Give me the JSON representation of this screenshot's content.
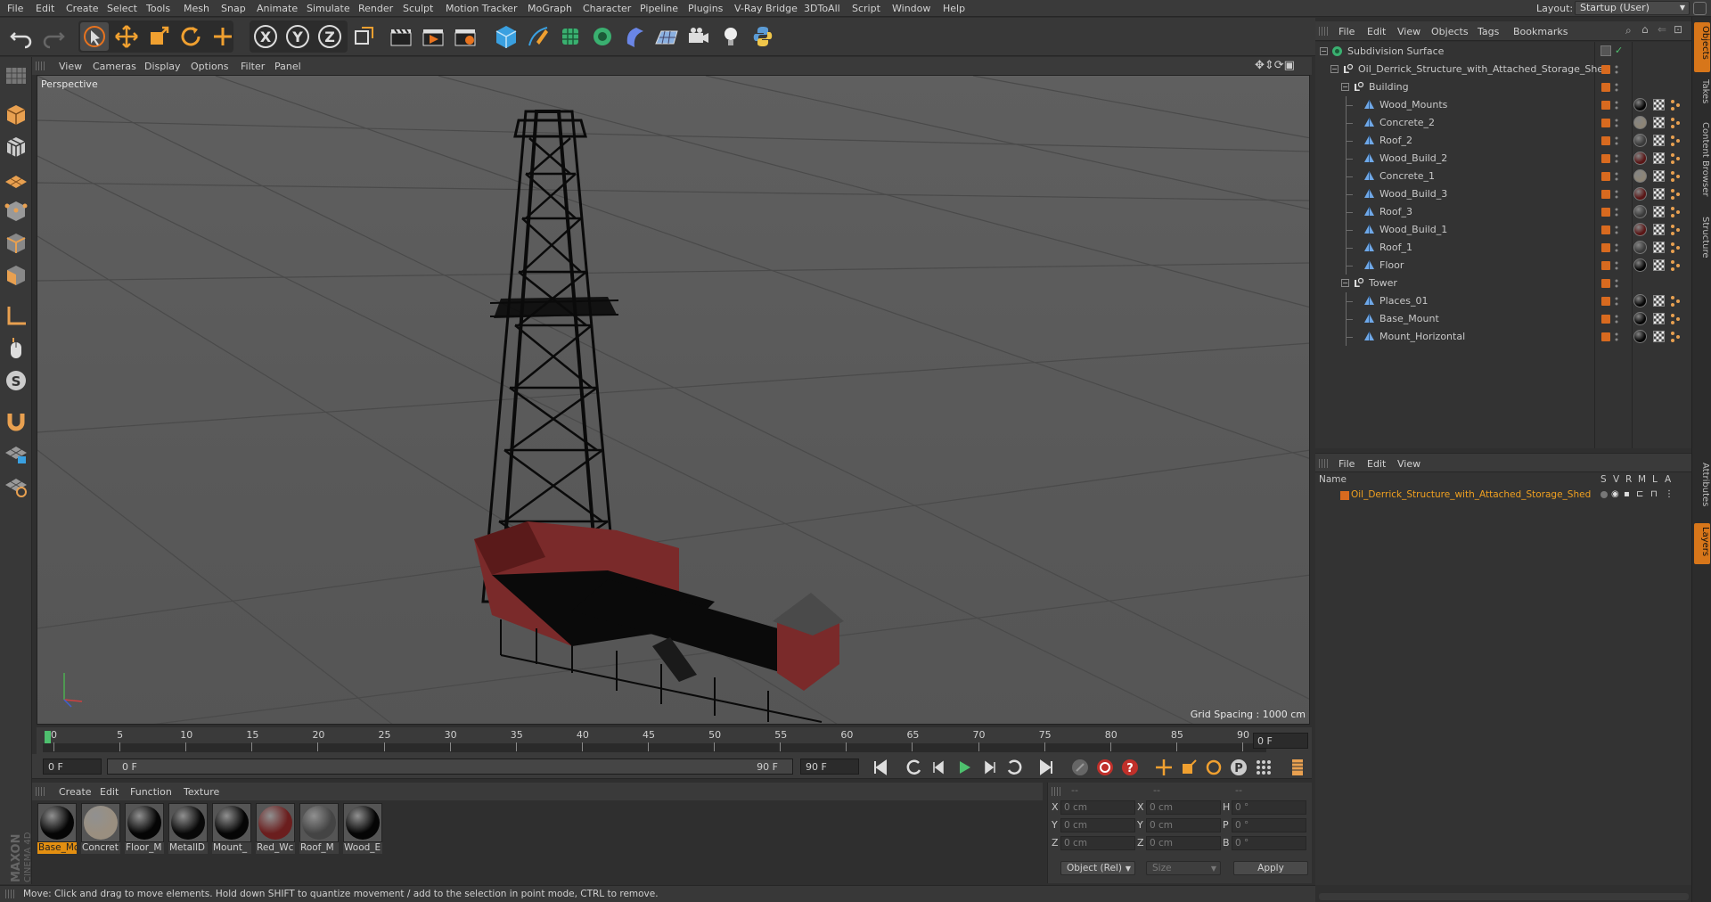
{
  "menubar": {
    "items": [
      "File",
      "Edit",
      "Create",
      "Select",
      "Tools",
      "Mesh",
      "Snap",
      "Animate",
      "Simulate",
      "Render",
      "Sculpt",
      "Motion Tracker",
      "MoGraph",
      "Character",
      "Pipeline",
      "Plugins",
      "V-Ray Bridge",
      "3DToAll",
      "Script",
      "Window",
      "Help"
    ],
    "layout_label": "Layout:",
    "layout_value": "Startup (User)"
  },
  "viewport": {
    "menu": [
      "View",
      "Cameras",
      "Display",
      "Options",
      "Filter",
      "Panel"
    ],
    "label": "Perspective",
    "grid_spacing": "Grid Spacing : 1000 cm"
  },
  "timeline": {
    "ticks": [
      "0",
      "5",
      "10",
      "15",
      "20",
      "25",
      "30",
      "35",
      "40",
      "45",
      "50",
      "55",
      "60",
      "65",
      "70",
      "75",
      "80",
      "85",
      "90"
    ],
    "end_field": "0 F",
    "current_frame": "0 F",
    "range_start": "0 F",
    "range_end": "90 F",
    "max_frame": "90 F"
  },
  "materials": {
    "menu": [
      "Create",
      "Edit",
      "Function",
      "Texture"
    ],
    "items": [
      {
        "name": "Base_Mo",
        "color": "#050505",
        "selected": true
      },
      {
        "name": "Concret",
        "color": "#9a8f80",
        "selected": false
      },
      {
        "name": "Floor_M",
        "color": "#050505",
        "selected": false
      },
      {
        "name": "MetallD",
        "color": "#080808",
        "selected": false
      },
      {
        "name": "Mount_",
        "color": "#050505",
        "selected": false
      },
      {
        "name": "Red_Wc",
        "color": "#6b1e1e",
        "selected": false
      },
      {
        "name": "Roof_M",
        "color": "#444444",
        "selected": false
      },
      {
        "name": "Wood_E",
        "color": "#050505",
        "selected": false
      }
    ],
    "brand": "MAXON CINEMA 4D"
  },
  "coords": {
    "header": [
      "--",
      "--",
      "--"
    ],
    "rows": [
      {
        "l1": "X",
        "v1": "0 cm",
        "l2": "X",
        "v2": "0 cm",
        "l3": "H",
        "v3": "0 °"
      },
      {
        "l1": "Y",
        "v1": "0 cm",
        "l2": "Y",
        "v2": "0 cm",
        "l3": "P",
        "v3": "0 °"
      },
      {
        "l1": "Z",
        "v1": "0 cm",
        "l2": "Z",
        "v2": "0 cm",
        "l3": "B",
        "v3": "0 °"
      }
    ],
    "mode": "Object (Rel)",
    "size": "Size",
    "apply": "Apply"
  },
  "status": "Move: Click and drag to move elements. Hold down SHIFT to quantize movement / add to the selection in point mode, CTRL to remove.",
  "object_manager": {
    "menu": [
      "File",
      "Edit",
      "View",
      "Objects",
      "Tags",
      "Bookmarks"
    ],
    "objects": [
      {
        "name": "Subdivision Surface",
        "depth": 0,
        "type": "subdiv",
        "tag": null
      },
      {
        "name": "Oil_Derrick_Structure_with_Attached_Storage_Shed",
        "depth": 1,
        "type": "null",
        "tag": null
      },
      {
        "name": "Building",
        "depth": 2,
        "type": "null",
        "tag": null
      },
      {
        "name": "Wood_Mounts",
        "depth": 3,
        "type": "poly",
        "tag": "#060606"
      },
      {
        "name": "Concrete_2",
        "depth": 3,
        "type": "poly",
        "tag": "#8d8576"
      },
      {
        "name": "Roof_2",
        "depth": 3,
        "type": "poly",
        "tag": "#3a3a3a"
      },
      {
        "name": "Wood_Build_2",
        "depth": 3,
        "type": "poly",
        "tag": "#5a1616"
      },
      {
        "name": "Concrete_1",
        "depth": 3,
        "type": "poly",
        "tag": "#8d8576"
      },
      {
        "name": "Wood_Build_3",
        "depth": 3,
        "type": "poly",
        "tag": "#5a1616"
      },
      {
        "name": "Roof_3",
        "depth": 3,
        "type": "poly",
        "tag": "#3a3a3a"
      },
      {
        "name": "Wood_Build_1",
        "depth": 3,
        "type": "poly",
        "tag": "#5a1616"
      },
      {
        "name": "Roof_1",
        "depth": 3,
        "type": "poly",
        "tag": "#3a3a3a"
      },
      {
        "name": "Floor",
        "depth": 3,
        "type": "poly",
        "tag": "#060606"
      },
      {
        "name": "Tower",
        "depth": 2,
        "type": "null",
        "tag": null
      },
      {
        "name": "Places_01",
        "depth": 3,
        "type": "poly",
        "tag": "#060606"
      },
      {
        "name": "Base_Mount",
        "depth": 3,
        "type": "poly",
        "tag": "#060606"
      },
      {
        "name": "Mount_Horizontal",
        "depth": 3,
        "type": "poly",
        "tag": "#060606"
      }
    ]
  },
  "layer_manager": {
    "menu": [
      "File",
      "Edit",
      "View"
    ],
    "columns": [
      "Name",
      "S",
      "V",
      "R",
      "M",
      "L",
      "A"
    ],
    "layer": "Oil_Derrick_Structure_with_Attached_Storage_Shed"
  },
  "side_tabs": [
    "Objects",
    "Takes",
    "Content Browser",
    "Structure",
    "Attributes",
    "Layers"
  ],
  "colors": {
    "accent": "#e38f11",
    "layer": "#d86a1f"
  }
}
